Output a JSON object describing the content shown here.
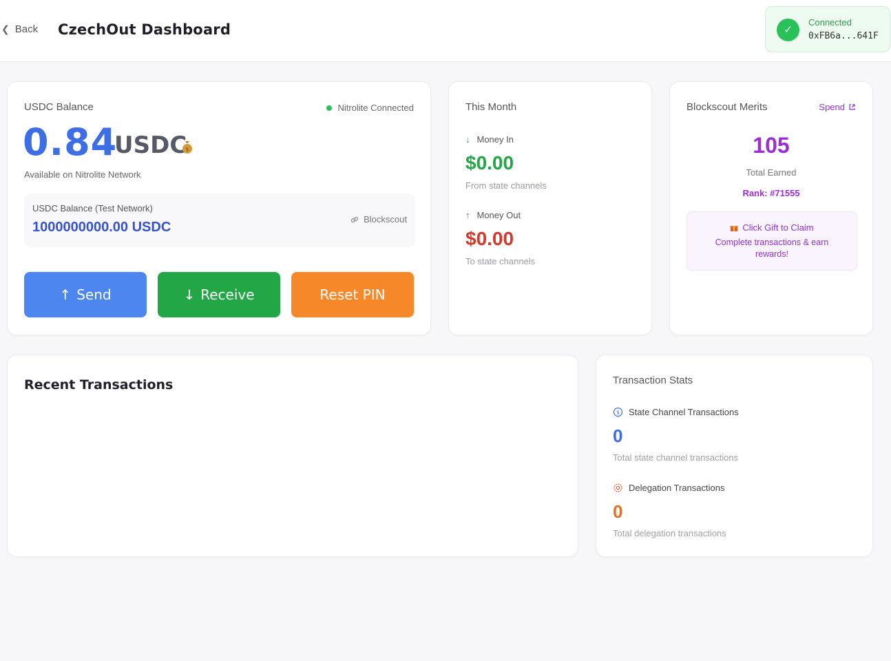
{
  "header": {
    "back_label": "Back",
    "title": "CzechOut Dashboard",
    "connection": {
      "status": "Connected",
      "address": "0xFB6a...641F"
    }
  },
  "balance": {
    "label": "USDC Balance",
    "status": "Nitrolite Connected",
    "amount": "0.84",
    "unit": "USDC",
    "available": "Available on Nitrolite Network",
    "test_label": "USDC Balance (Test Network)",
    "test_value": "1000000000.00 USDC",
    "explorer_link": "Blockscout",
    "actions": {
      "send": "Send",
      "receive": "Receive",
      "reset": "Reset PIN"
    }
  },
  "month": {
    "title": "This Month",
    "money_in": {
      "label": "Money In",
      "value": "$0.00",
      "sub": "From state channels"
    },
    "money_out": {
      "label": "Money Out",
      "value": "$0.00",
      "sub": "To state channels"
    }
  },
  "merits": {
    "title": "Blockscout Merits",
    "spend": "Spend",
    "value": "105",
    "total_label": "Total Earned",
    "rank": "Rank: #71555",
    "gift_title": "Click Gift to Claim",
    "gift_desc": "Complete transactions & earn rewards!"
  },
  "recent": {
    "title": "Recent Transactions"
  },
  "stats": {
    "title": "Transaction Stats",
    "state_channel": {
      "label": "State Channel Transactions",
      "value": "0",
      "sub": "Total state channel transactions"
    },
    "delegation": {
      "label": "Delegation Transactions",
      "value": "0",
      "sub": "Total delegation transactions"
    }
  },
  "colors": {
    "primary": "#3d6ee6",
    "success": "#22a646",
    "danger": "#d33a2c",
    "warning": "#f7882a",
    "merit": "#9a2fd3"
  }
}
